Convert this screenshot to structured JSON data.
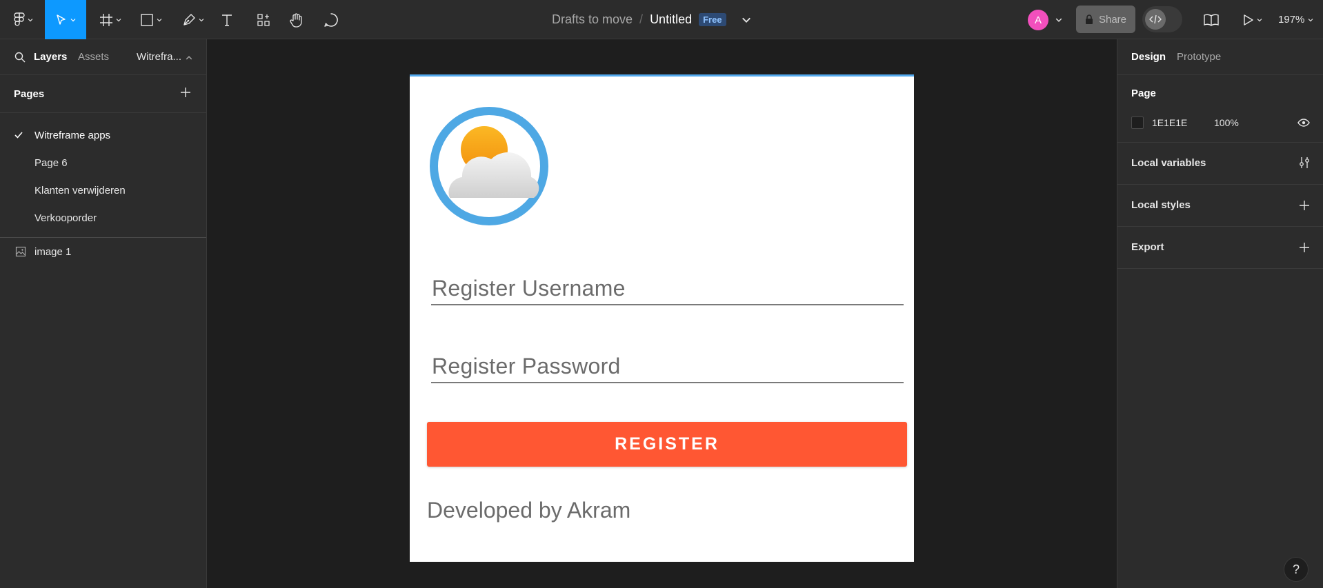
{
  "toolbar": {
    "breadcrumb": "Drafts to move",
    "separator": "/",
    "title": "Untitled",
    "plan_badge": "Free",
    "avatar_initial": "A",
    "share_label": "Share",
    "zoom": "197%",
    "tools": [
      "figma-menu-icon",
      "move-icon",
      "frame-icon",
      "rectangle-icon",
      "pen-icon",
      "text-icon",
      "resources-icon",
      "hand-icon",
      "comment-icon"
    ]
  },
  "left_panel": {
    "tab_layers": "Layers",
    "tab_assets": "Assets",
    "page_selector": "Witrefra...",
    "pages_title": "Pages",
    "pages": [
      {
        "label": "Witreframe apps",
        "current": true
      },
      {
        "label": "Page 6",
        "current": false
      },
      {
        "label": "Klanten verwijderen",
        "current": false
      },
      {
        "label": "Verkooporder",
        "current": false
      }
    ],
    "layers": [
      {
        "label": "image 1",
        "icon": "image-icon"
      }
    ]
  },
  "right_panel": {
    "tab_design": "Design",
    "tab_prototype": "Prototype",
    "page_title": "Page",
    "page_color": "1E1E1E",
    "page_opacity": "100%",
    "local_variables": "Local variables",
    "local_styles": "Local styles",
    "export": "Export"
  },
  "canvas": {
    "username_placeholder": "Register Username",
    "password_placeholder": "Register Password",
    "register_button": "REGISTER",
    "footer_text": "Developed by Akram"
  },
  "help_label": "?",
  "colors": {
    "accent": "#0d99ff",
    "register_button": "#ff5733",
    "avatar": "#f24fbd",
    "logo_ring": "#4ea8e4",
    "sun": "#f7a21b"
  }
}
